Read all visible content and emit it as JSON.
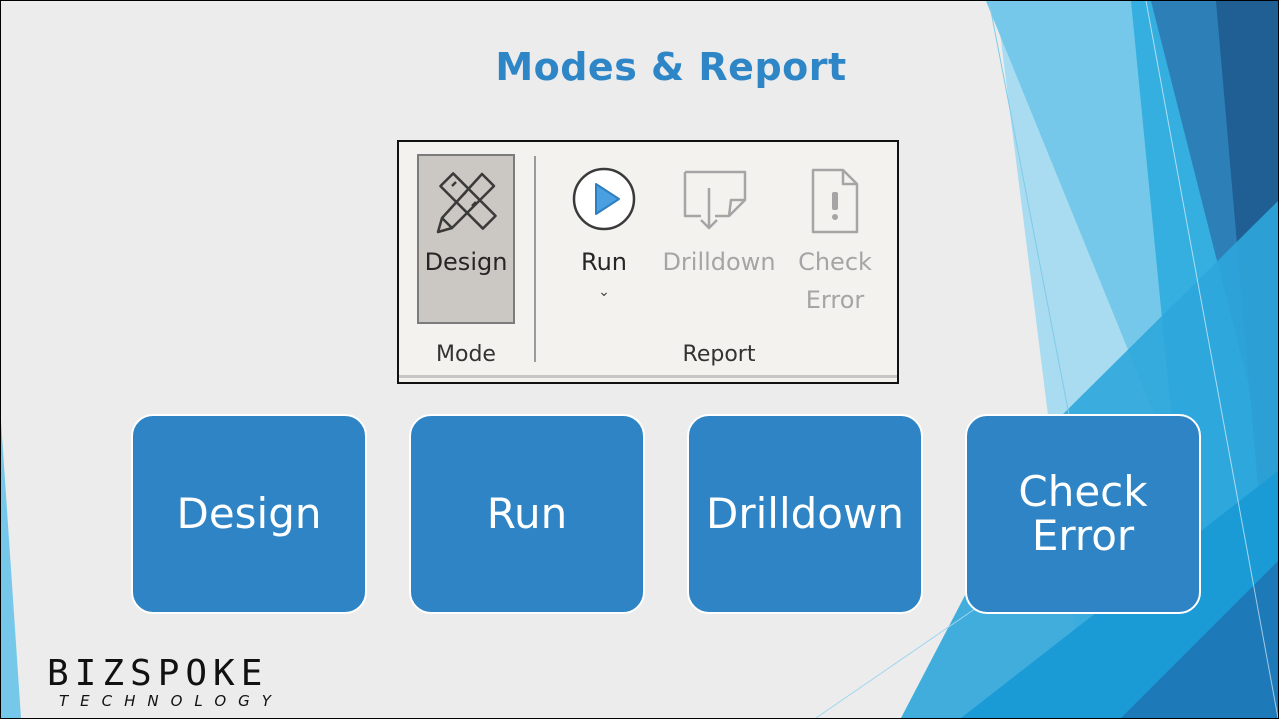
{
  "slide": {
    "title": "Modes & Report"
  },
  "ribbon": {
    "mode_group": {
      "label": "Mode",
      "design_button": {
        "label": "Design",
        "icon": "design-ruler-pencil-icon",
        "selected": true
      }
    },
    "report_group": {
      "label": "Report",
      "run_button": {
        "label": "Run",
        "icon": "play-circle-icon",
        "chevron": "⌄"
      },
      "drilldown_button": {
        "label": "Drilldown",
        "icon": "drilldown-arrow-icon",
        "enabled": false
      },
      "check_error_button": {
        "label_line1": "Check",
        "label_line2": "Error",
        "icon": "document-exclamation-icon",
        "enabled": false
      }
    }
  },
  "mode_boxes": [
    {
      "label": "Design"
    },
    {
      "label": "Run"
    },
    {
      "label": "Drilldown"
    },
    {
      "label_line1": "Check",
      "label_line2": "Error"
    }
  ],
  "logo": {
    "main": "BIZSPOKE",
    "sub": "TECHNOLOGY"
  },
  "colors": {
    "slide_background": "#ececec",
    "title": "#2e86c7",
    "box_fill": "#2e84c4",
    "ribbon_background": "#f4f2ef",
    "ribbon_selected": "#cbc7c2",
    "accent_blue_light": "#75c8ea",
    "accent_blue_dark": "#1f5f93"
  }
}
